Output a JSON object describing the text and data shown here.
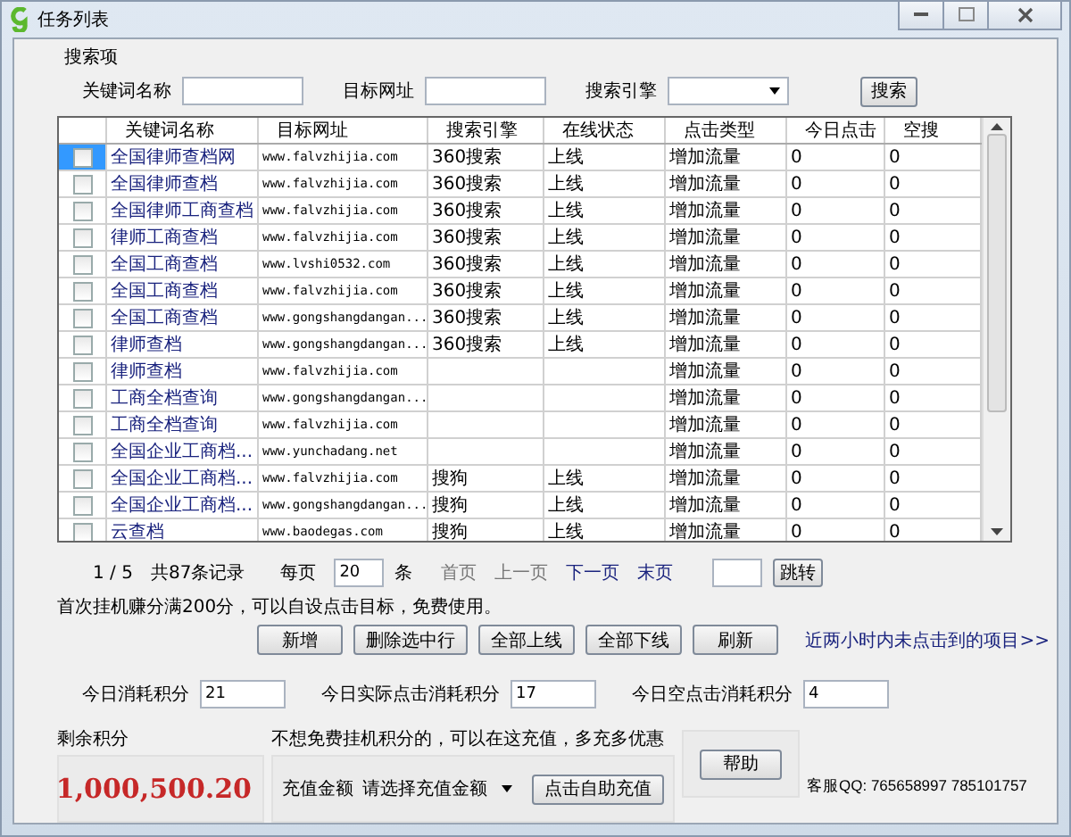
{
  "window": {
    "title": "任务列表"
  },
  "search": {
    "group_title": "搜索项",
    "keyword_label": "关键词名称",
    "url_label": "目标网址",
    "engine_label": "搜索引擎",
    "button": "搜索"
  },
  "table": {
    "columns": [
      "关键词名称",
      "目标网址",
      "搜索引擎",
      "在线状态",
      "点击类型",
      "今日点击",
      "空搜"
    ],
    "rows": [
      {
        "selected": true,
        "checked": false,
        "keyword": "全国律师查档网",
        "url": "www.falvzhijia.com",
        "engine": "360搜索",
        "status": "上线",
        "type": "增加流量",
        "today": "0",
        "empty": "0"
      },
      {
        "selected": false,
        "checked": false,
        "keyword": "全国律师查档",
        "url": "www.falvzhijia.com",
        "engine": "360搜索",
        "status": "上线",
        "type": "增加流量",
        "today": "0",
        "empty": "0"
      },
      {
        "selected": false,
        "checked": false,
        "keyword": "全国律师工商查档",
        "url": "www.falvzhijia.com",
        "engine": "360搜索",
        "status": "上线",
        "type": "增加流量",
        "today": "0",
        "empty": "0"
      },
      {
        "selected": false,
        "checked": false,
        "keyword": "律师工商查档",
        "url": "www.falvzhijia.com",
        "engine": "360搜索",
        "status": "上线",
        "type": "增加流量",
        "today": "0",
        "empty": "0"
      },
      {
        "selected": false,
        "checked": false,
        "keyword": "全国工商查档",
        "url": "www.lvshi0532.com",
        "engine": "360搜索",
        "status": "上线",
        "type": "增加流量",
        "today": "0",
        "empty": "0"
      },
      {
        "selected": false,
        "checked": false,
        "keyword": "全国工商查档",
        "url": "www.falvzhijia.com",
        "engine": "360搜索",
        "status": "上线",
        "type": "增加流量",
        "today": "0",
        "empty": "0"
      },
      {
        "selected": false,
        "checked": false,
        "keyword": "全国工商查档",
        "url": "www.gongshangdangan...",
        "engine": "360搜索",
        "status": "上线",
        "type": "增加流量",
        "today": "0",
        "empty": "0"
      },
      {
        "selected": false,
        "checked": false,
        "keyword": "律师查档",
        "url": "www.gongshangdangan...",
        "engine": "360搜索",
        "status": "上线",
        "type": "增加流量",
        "today": "0",
        "empty": "0"
      },
      {
        "selected": false,
        "checked": false,
        "keyword": "律师查档",
        "url": "www.falvzhijia.com",
        "type": "增加流量",
        "today": "0",
        "empty": "0"
      },
      {
        "selected": false,
        "checked": false,
        "keyword": "工商全档查询",
        "url": "www.gongshangdangan...",
        "type": "增加流量",
        "today": "0",
        "empty": "0"
      },
      {
        "selected": false,
        "checked": false,
        "keyword": "工商全档查询",
        "url": "www.falvzhijia.com",
        "type": "增加流量",
        "today": "0",
        "empty": "0"
      },
      {
        "selected": false,
        "checked": false,
        "keyword": "全国企业工商档...",
        "url": "www.yunchadang.net",
        "type": "增加流量",
        "today": "0",
        "empty": "0"
      },
      {
        "selected": false,
        "checked": false,
        "keyword": "全国企业工商档...",
        "url": "www.falvzhijia.com",
        "engine": "搜狗",
        "status": "上线",
        "type": "增加流量",
        "today": "0",
        "empty": "0"
      },
      {
        "selected": false,
        "checked": false,
        "keyword": "全国企业工商档...",
        "url": "www.gongshangdangan...",
        "engine": "搜狗",
        "status": "上线",
        "type": "增加流量",
        "today": "0",
        "empty": "0"
      },
      {
        "selected": false,
        "checked": false,
        "keyword": "云查档",
        "url": "www.baodegas.com",
        "engine": "搜狗",
        "status": "上线",
        "type": "增加流量",
        "today": "0",
        "empty": "0"
      }
    ]
  },
  "pager": {
    "page": "1 / 5",
    "total": "共87条记录",
    "per_page_label": "每页",
    "per_page": "20",
    "unit": "条",
    "links": [
      {
        "label": "首页",
        "disabled": true
      },
      {
        "label": "上一页",
        "disabled": true
      },
      {
        "label": "下一页",
        "disabled": false
      },
      {
        "label": "末页",
        "disabled": false
      }
    ],
    "jump_button": "跳转"
  },
  "notice": "首次挂机赚分满200分，可以自设点击目标，免费使用。",
  "actions": [
    "新增",
    "删除选中行",
    "全部上线",
    "全部下线",
    "刷新"
  ],
  "recent_link": "近两小时内未点击到的项目>>",
  "stats": [
    {
      "label": "今日消耗积分",
      "value": "21"
    },
    {
      "label": "今日实际点击消耗积分",
      "value": "17"
    },
    {
      "label": "今日空点击消耗积分",
      "value": "4"
    }
  ],
  "balance": {
    "label": "剩余积分",
    "value": "1,000,500.20"
  },
  "recharge": {
    "title": "不想免费挂机积分的，可以在这充值，多充多优惠",
    "amount_label": "充值金额",
    "amount_select": "请选择充值金额",
    "button": "点击自助充值"
  },
  "help_button": "帮助",
  "support": "客服QQ: 765658997 785101757"
}
